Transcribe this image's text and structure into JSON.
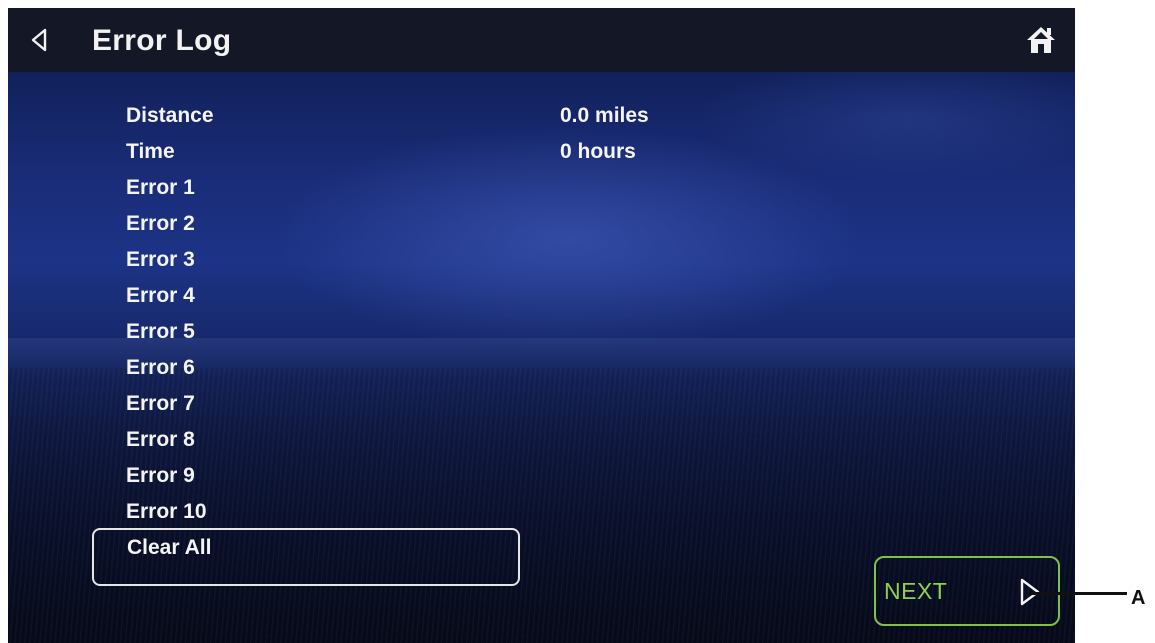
{
  "header": {
    "title": "Error Log",
    "back_icon": "chevron-left-outline-icon",
    "home_icon": "home-icon"
  },
  "log": {
    "rows": [
      {
        "label": "Distance",
        "value": "0.0 miles"
      },
      {
        "label": "Time",
        "value": "0 hours"
      },
      {
        "label": "Error 1",
        "value": ""
      },
      {
        "label": "Error 2",
        "value": ""
      },
      {
        "label": "Error 3",
        "value": ""
      },
      {
        "label": "Error 4",
        "value": ""
      },
      {
        "label": "Error 5",
        "value": ""
      },
      {
        "label": "Error 6",
        "value": ""
      },
      {
        "label": "Error 7",
        "value": ""
      },
      {
        "label": "Error 8",
        "value": ""
      },
      {
        "label": "Error 9",
        "value": ""
      },
      {
        "label": "Error 10",
        "value": ""
      }
    ]
  },
  "actions": {
    "clear_all_label": "Clear All",
    "next_label": "NEXT",
    "next_icon": "chevron-right-outline-icon"
  },
  "annotation": {
    "callout_label": "A"
  },
  "colors": {
    "titlebar": "#141826",
    "text": "#f4f4f4",
    "next_accent": "#8fd14f",
    "sky": "#1c3386"
  }
}
